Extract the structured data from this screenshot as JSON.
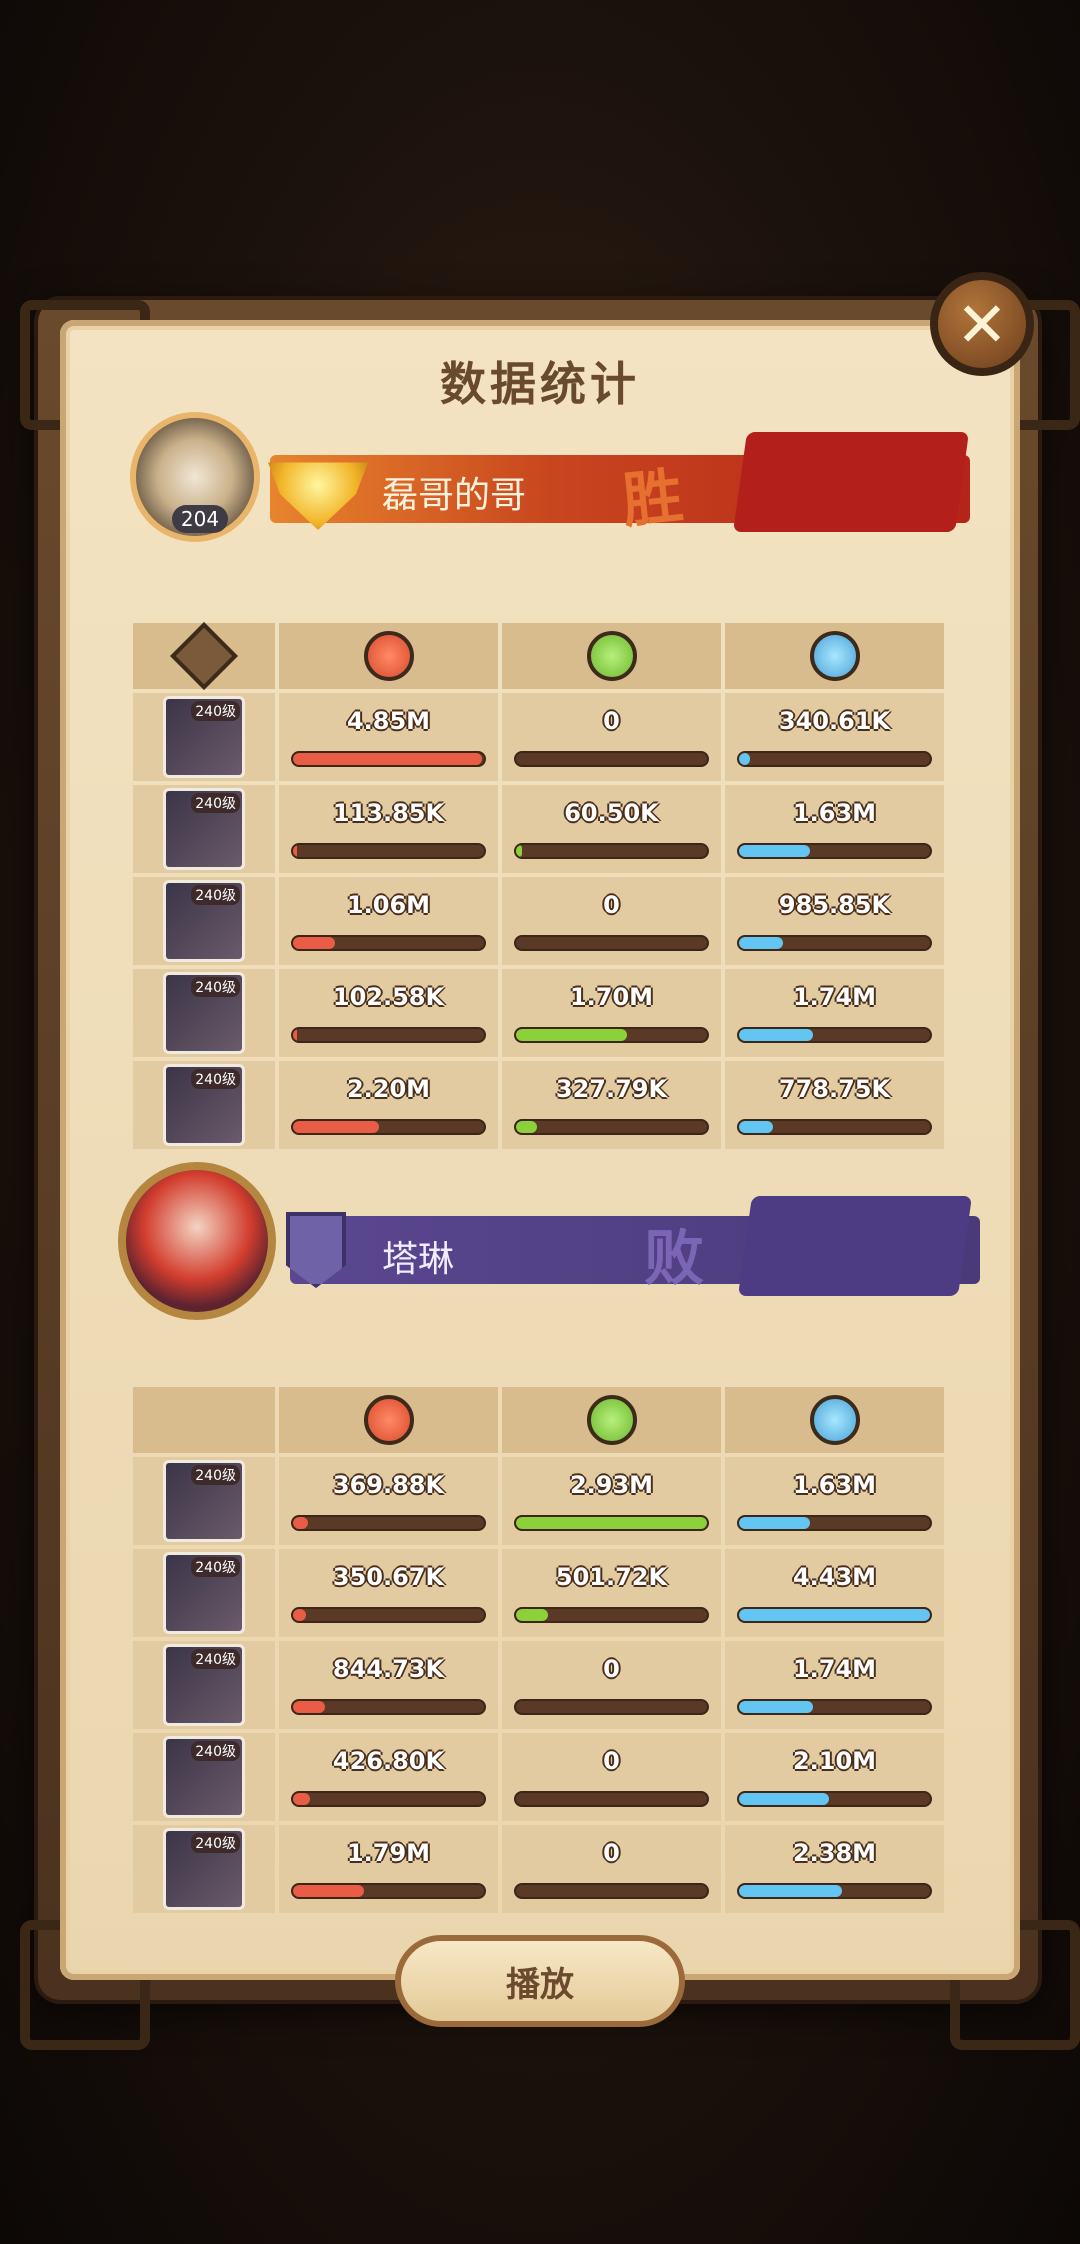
{
  "title": "数据统计",
  "close": "✕",
  "player1": {
    "name": "磊哥的哥",
    "level": "204",
    "result": "胜",
    "heroes": [
      {
        "level": "240级",
        "damage": "4.85M",
        "heal": "0",
        "defense": "340.61K",
        "damage_ratio": 0.99,
        "heal_ratio": 0.0,
        "defense_ratio": 0.06
      },
      {
        "level": "240级",
        "damage": "113.85K",
        "heal": "60.50K",
        "defense": "1.63M",
        "damage_ratio": 0.02,
        "heal_ratio": 0.03,
        "defense_ratio": 0.37
      },
      {
        "level": "240级",
        "damage": "1.06M",
        "heal": "0",
        "defense": "985.85K",
        "damage_ratio": 0.22,
        "heal_ratio": 0.0,
        "defense_ratio": 0.23
      },
      {
        "level": "240级",
        "damage": "102.58K",
        "heal": "1.70M",
        "defense": "1.74M",
        "damage_ratio": 0.02,
        "heal_ratio": 0.58,
        "defense_ratio": 0.39
      },
      {
        "level": "240级",
        "damage": "2.20M",
        "heal": "327.79K",
        "defense": "778.75K",
        "damage_ratio": 0.45,
        "heal_ratio": 0.11,
        "defense_ratio": 0.18
      }
    ]
  },
  "player2": {
    "name": "塔琳",
    "result": "败",
    "heroes": [
      {
        "level": "240级",
        "damage": "369.88K",
        "heal": "2.93M",
        "defense": "1.63M",
        "damage_ratio": 0.08,
        "heal_ratio": 1.0,
        "defense_ratio": 0.37
      },
      {
        "level": "240级",
        "damage": "350.67K",
        "heal": "501.72K",
        "defense": "4.43M",
        "damage_ratio": 0.07,
        "heal_ratio": 0.17,
        "defense_ratio": 1.0
      },
      {
        "level": "240级",
        "damage": "844.73K",
        "heal": "0",
        "defense": "1.74M",
        "damage_ratio": 0.17,
        "heal_ratio": 0.0,
        "defense_ratio": 0.39
      },
      {
        "level": "240级",
        "damage": "426.80K",
        "heal": "0",
        "defense": "2.10M",
        "damage_ratio": 0.09,
        "heal_ratio": 0.0,
        "defense_ratio": 0.47
      },
      {
        "level": "240级",
        "damage": "1.79M",
        "heal": "0",
        "defense": "2.38M",
        "damage_ratio": 0.37,
        "heal_ratio": 0.0,
        "defense_ratio": 0.54
      }
    ]
  },
  "play_button": "播放",
  "colors": {
    "damage": "#e95d46",
    "heal": "#8cd13a",
    "defense": "#63c6f2"
  }
}
